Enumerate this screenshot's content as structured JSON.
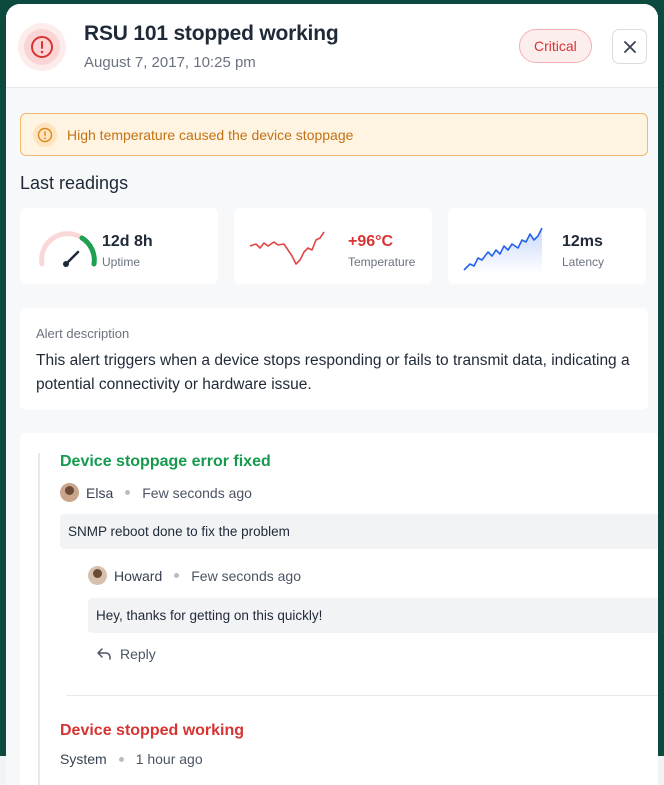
{
  "header": {
    "title": "RSU 101 stopped working",
    "subtitle": "August 7, 2017, 10:25 pm",
    "badge": "Critical",
    "close_icon": "close-icon",
    "alert_icon": "alert-circle-icon"
  },
  "banner": {
    "icon": "warning-circle-icon",
    "text": "High temperature caused the device stoppage"
  },
  "readings": {
    "title": "Last readings",
    "items": [
      {
        "value": "12d 8h",
        "label": "Uptime",
        "icon": "gauge-icon"
      },
      {
        "value": "+96°C",
        "label": "Temperature",
        "icon": "sparkline-icon"
      },
      {
        "value": "12ms",
        "label": "Latency",
        "icon": "sparkline-icon"
      }
    ]
  },
  "description": {
    "label": "Alert description",
    "text": "This alert triggers when a device stops responding or fails to transmit data, indicating a potential connectivity or hardware issue."
  },
  "timeline": {
    "events": [
      {
        "title": "Device stoppage error fixed",
        "author": "Elsa",
        "time": "Few seconds ago",
        "message": "SNMP reboot done to fix the problem",
        "reply": {
          "author": "Howard",
          "time": "Few seconds ago",
          "message": "Hey, thanks for getting on this quickly!"
        },
        "reply_label": "Reply"
      },
      {
        "title": "Device stopped working",
        "author": "System",
        "time": "1 hour ago"
      }
    ]
  },
  "colors": {
    "critical": "#d73434",
    "warning": "#c27314",
    "success": "#169a4e",
    "frame": "#0c4a40"
  }
}
